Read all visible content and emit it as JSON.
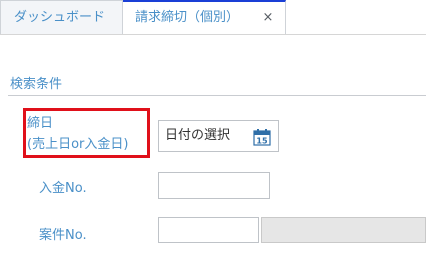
{
  "tabs": [
    {
      "label": "ダッシュボード"
    },
    {
      "label": "請求締切（個別）",
      "close": "×"
    }
  ],
  "search_conditions": {
    "title": "検索条件",
    "closing_date": {
      "label_line1": "締日",
      "label_line2": "(売上日or入金日)",
      "placeholder": "日付の選択",
      "calendar_day": "15"
    },
    "payment_no": {
      "label": "入金No.",
      "value": ""
    },
    "project_no": {
      "label": "案件No.",
      "value": "",
      "name_value": ""
    }
  },
  "colors": {
    "accent": "#4a90c8",
    "active_tab_border": "#1a3fd6",
    "highlight": "#e0101a",
    "calendar_icon": "#2f6fa8"
  }
}
